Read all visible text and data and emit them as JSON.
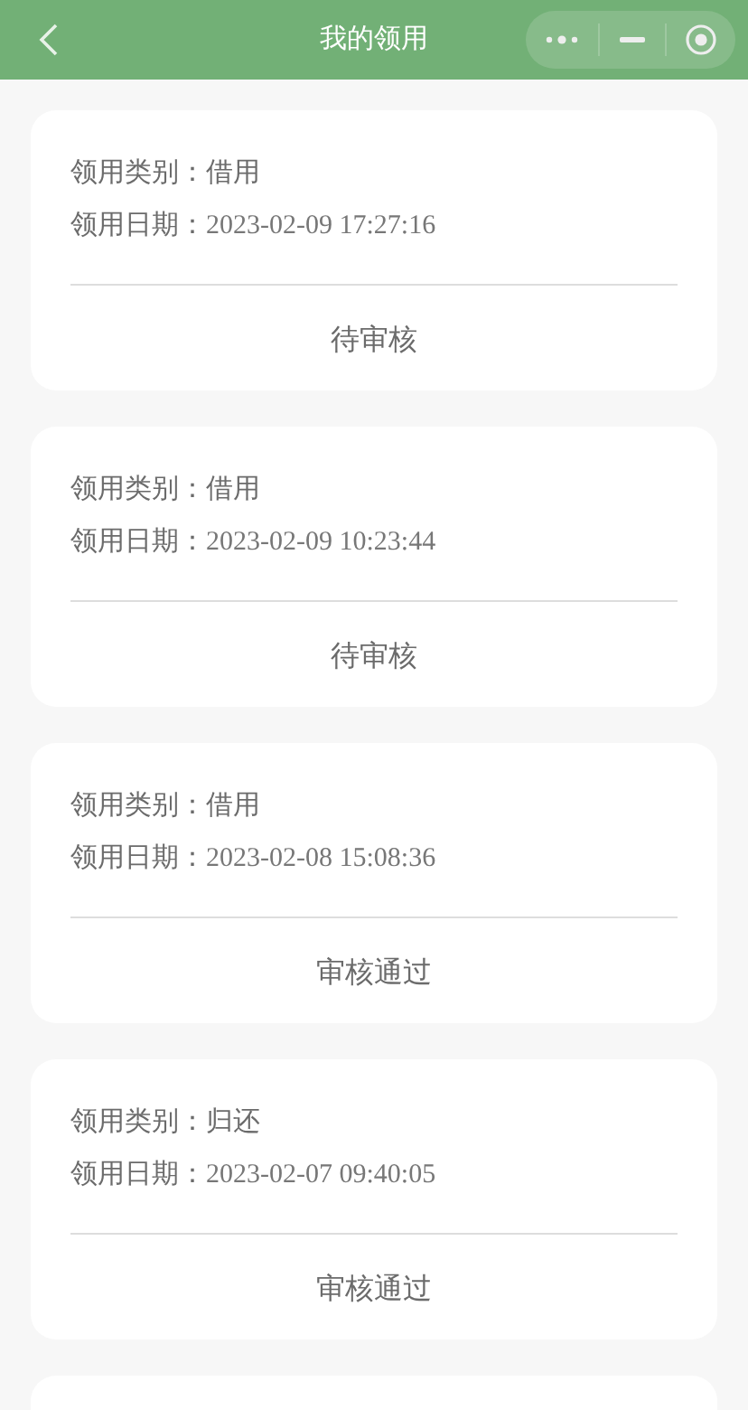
{
  "nav_bar": {
    "title": "我的领用"
  },
  "records": [
    {
      "category_label": "领用类别：",
      "category": "借用",
      "date_label": "领用日期：",
      "date": "2023-02-09 17:27:16",
      "status": "待审核"
    },
    {
      "category_label": "领用类别：",
      "category": "借用",
      "date_label": "领用日期：",
      "date": "2023-02-09 10:23:44",
      "status": "待审核"
    },
    {
      "category_label": "领用类别：",
      "category": "借用",
      "date_label": "领用日期：",
      "date": "2023-02-08 15:08:36",
      "status": "审核通过"
    },
    {
      "category_label": "领用类别：",
      "category": "归还",
      "date_label": "领用日期：",
      "date": "2023-02-07 09:40:05",
      "status": "审核通过"
    }
  ]
}
